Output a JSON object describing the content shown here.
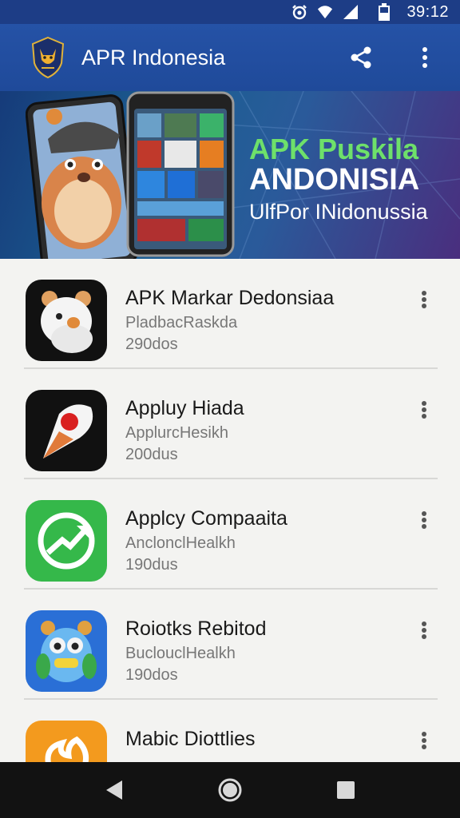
{
  "status_bar": {
    "time": "39:12",
    "icons": [
      "alarm-icon",
      "wifi-icon",
      "signal-icon",
      "battery-icon"
    ]
  },
  "app_bar": {
    "title": "APR Indonesia",
    "logo": "fox-shield-logo",
    "actions": [
      "share-icon",
      "more-vert-icon"
    ]
  },
  "banner": {
    "headline_line1": "APK Puskila",
    "headline_line2": "ANDONISIA",
    "headline_line3": "UlfPor INidonussia",
    "colors": {
      "line1": "#6ee06a",
      "line2": "#ffffff",
      "line3": "#ffffff"
    }
  },
  "apps": [
    {
      "name": "APK Markar Dedonsiaa",
      "developer": "PladbacRaskda",
      "downloads": "290dos",
      "icon": "polar-bear-icon",
      "tile_color": "#111111"
    },
    {
      "name": "Appluy Hiada",
      "developer": "ApplurcHesikh",
      "downloads": "200dus",
      "icon": "location-pin-icon",
      "tile_color": "#111111"
    },
    {
      "name": "Applcy Compaaita",
      "developer": "AnclonclHealkh",
      "downloads": "190dus",
      "icon": "trending-arrow-icon",
      "tile_color": "#35b84a"
    },
    {
      "name": "Roiotks Rebitod",
      "developer": "BuclouclHealkh",
      "downloads": "190dos",
      "icon": "robot-owl-icon",
      "tile_color": "#2a6fd6"
    },
    {
      "name": "Mabic Diottlies",
      "developer": "",
      "downloads": "",
      "icon": "flame-swirl-icon",
      "tile_color": "#f39a1e"
    }
  ],
  "nav_bar": {
    "buttons": [
      "back-icon",
      "home-icon",
      "recents-icon"
    ]
  }
}
